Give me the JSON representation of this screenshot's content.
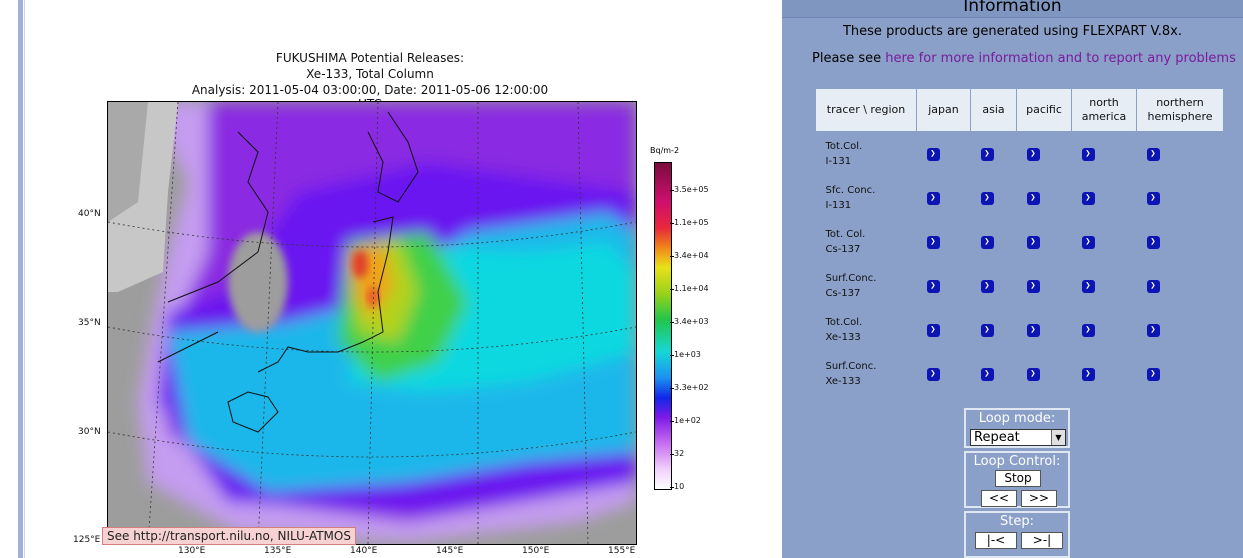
{
  "figure": {
    "title_line1": "FUKUSHIMA Potential Releases:",
    "title_line2": "Xe-133, Total Column",
    "title_line3": "Analysis: 2011-05-04  03:00:00, Date: 2011-05-06  12:00:00 UTC",
    "lat_labels": [
      "40°N",
      "35°N",
      "30°N",
      "125°E"
    ],
    "lon_labels": [
      "130°E",
      "135°E",
      "140°E",
      "145°E",
      "150°E",
      "155°E"
    ],
    "colorbar_unit": "Bq/m-2",
    "colorbar_labels": [
      "3.5e+05",
      "1.1e+05",
      "3.4e+04",
      "1.1e+04",
      "3.4e+03",
      "1e+03",
      "3.3e+02",
      "1e+02",
      "32",
      "10"
    ],
    "credit": "See http://transport.nilu.no, NILU-ATMOS"
  },
  "panel": {
    "title": "Information",
    "line1": "These products are generated using FLEXPART V.8x.",
    "line2_prefix": "Please see ",
    "line2_link": "here for more information and to report any problems",
    "link_color": "#7a1b9c"
  },
  "table": {
    "corner": "tracer \\ region",
    "regions": [
      "japan",
      "asia",
      "pacific",
      "north america",
      "northern hemisphere"
    ],
    "rows": [
      {
        "l1": "Tot.Col.",
        "l2": "I-131"
      },
      {
        "l1": "Sfc. Conc.",
        "l2": "I-131"
      },
      {
        "l1": "Tot. Col.",
        "l2": "Cs-137"
      },
      {
        "l1": "Surf.Conc.",
        "l2": "Cs-137"
      },
      {
        "l1": "Tot.Col.",
        "l2": "Xe-133"
      },
      {
        "l1": "Surf.Conc.",
        "l2": "Xe-133"
      }
    ]
  },
  "controls": {
    "loop_mode_title": "Loop mode:",
    "loop_mode_value": "Repeat",
    "loop_control_title": "Loop Control:",
    "stop_label": "Stop",
    "back_label": "<<",
    "fwd_label": ">>",
    "step_title": "Step:",
    "first_label": "|-<",
    "last_label": ">-|"
  }
}
